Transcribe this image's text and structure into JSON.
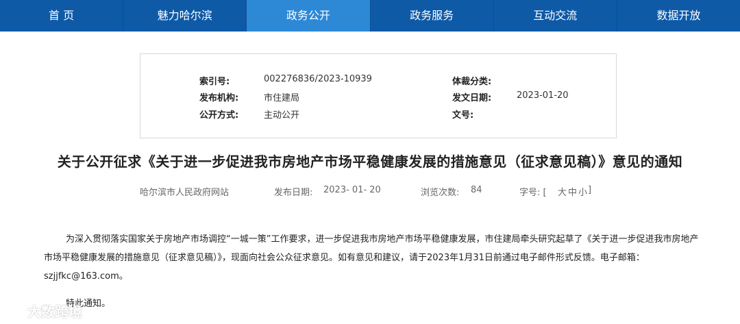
{
  "nav": {
    "items": [
      {
        "label": "首 页"
      },
      {
        "label": "魅力哈尔滨"
      },
      {
        "label": "政务公开"
      },
      {
        "label": "政务服务"
      },
      {
        "label": "互动交流"
      },
      {
        "label": "数据开放"
      }
    ],
    "active_index": 2
  },
  "meta": {
    "index_label": "索引号:",
    "index_value": "002276836/2023-10939",
    "genre_label": "体裁分类:",
    "genre_value": "",
    "publisher_label": "发布机构:",
    "publisher_value": "市住建局",
    "issue_date_label": "发文日期:",
    "issue_date_value": "2023-01-20",
    "open_mode_label": "公开方式:",
    "open_mode_value": "主动公开",
    "doc_no_label": "文号:",
    "doc_no_value": ""
  },
  "article": {
    "title": "关于公开征求《关于进一步促进我市房地产市场平稳健康发展的措施意见（征求意见稿）》意见的通知",
    "source": "哈尔滨市人民政府网站",
    "publish_label": "发布日期:",
    "publish_date": "2023- 01- 20",
    "views_label": "浏览次数:",
    "views_value": "84",
    "font_size_label": "字号: [",
    "font_large": "大",
    "font_medium": "中",
    "font_small": "小",
    "font_size_end": "]",
    "body": "为深入贯彻落实国家关于房地产市场调控“一城一策”工作要求，进一步促进我市房地产市场平稳健康发展，市住建局牵头研究起草了《关于进一步促进我市房地产市场平稳健康发展的措施意见（征求意见稿）》，现面向社会公众征求意见。如有意见和建议，请于2023年1月31日前通过电子邮件形式反馈。电子邮箱：szjjfkc@163.com。",
    "notice": "特此通知。"
  },
  "watermark": {
    "text": "大数跨境"
  }
}
